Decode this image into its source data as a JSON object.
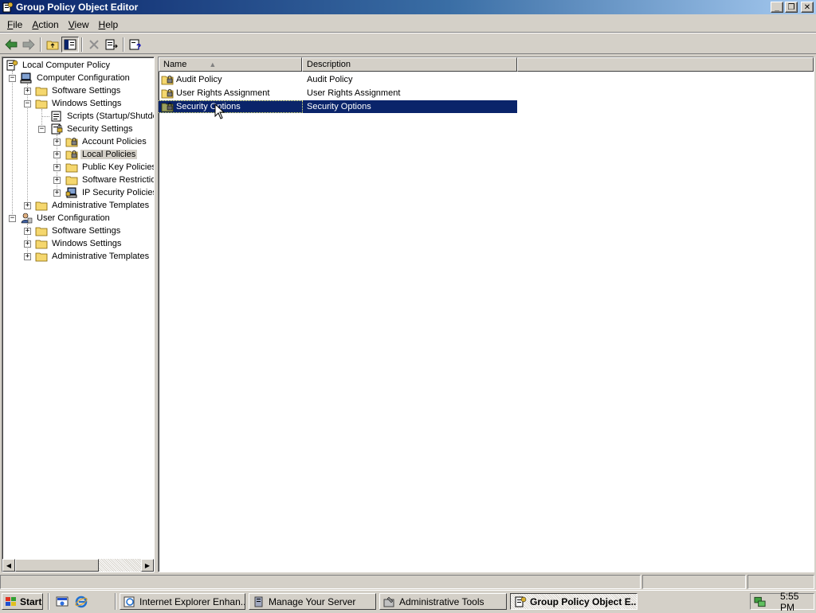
{
  "window": {
    "title": "Group Policy Object Editor",
    "controls": {
      "minimize": "_",
      "maximize": "❐",
      "close": "✕"
    }
  },
  "menubar": {
    "items": [
      {
        "label": "File",
        "accel": "F",
        "rest": "ile"
      },
      {
        "label": "Action",
        "accel": "A",
        "rest": "ction"
      },
      {
        "label": "View",
        "accel": "V",
        "rest": "iew"
      },
      {
        "label": "Help",
        "accel": "H",
        "rest": "elp"
      }
    ]
  },
  "toolbar": {
    "buttons": [
      "back-icon",
      "forward-icon",
      "up-folder-icon",
      "show-hide-tree-icon",
      "delete-icon",
      "export-list-icon",
      "help-icon"
    ]
  },
  "tree": {
    "items": [
      {
        "label": "Local Computer Policy",
        "icon": "policy-icon"
      },
      {
        "label": "Computer Configuration",
        "icon": "computer-icon",
        "expander": "−"
      },
      {
        "label": "Software Settings",
        "icon": "folder-icon",
        "expander": "+"
      },
      {
        "label": "Windows Settings",
        "icon": "folder-icon",
        "expander": "−"
      },
      {
        "label": "Scripts (Startup/Shutdown)",
        "icon": "script-icon"
      },
      {
        "label": "Security Settings",
        "icon": "security-icon",
        "expander": "−"
      },
      {
        "label": "Account Policies",
        "icon": "folder-lock-icon",
        "expander": "+"
      },
      {
        "label": "Local Policies",
        "icon": "folder-lock-icon",
        "expander": "+"
      },
      {
        "label": "Public Key Policies",
        "icon": "folder-icon",
        "expander": "+"
      },
      {
        "label": "Software Restriction Policies",
        "icon": "folder-icon",
        "expander": "+"
      },
      {
        "label": "IP Security Policies on Local Computer",
        "icon": "ipsec-icon",
        "expander": "+"
      },
      {
        "label": "Administrative Templates",
        "icon": "folder-icon",
        "expander": "+"
      },
      {
        "label": "User Configuration",
        "icon": "user-icon",
        "expander": "−"
      },
      {
        "label": "Software Settings",
        "icon": "folder-icon",
        "expander": "+"
      },
      {
        "label": "Windows Settings",
        "icon": "folder-icon",
        "expander": "+"
      },
      {
        "label": "Administrative Templates",
        "icon": "folder-icon",
        "expander": "+"
      }
    ],
    "selected": "Local Policies"
  },
  "list": {
    "columns": {
      "name": "Name",
      "description": "Description",
      "sort": "▲"
    },
    "rows": [
      {
        "name": "Audit Policy",
        "description": "Audit Policy"
      },
      {
        "name": "User Rights Assignment",
        "description": "User Rights Assignment"
      },
      {
        "name": "Security Options",
        "description": "Security Options"
      }
    ],
    "selected": "Security Options"
  },
  "taskbar": {
    "start_label": "Start",
    "quick_launch": [
      "show-desktop-icon",
      "internet-explorer-icon"
    ],
    "buttons": [
      {
        "label": "Internet Explorer Enhan...",
        "icon": "ie-doc-icon"
      },
      {
        "label": "Manage Your Server",
        "icon": "server-icon"
      },
      {
        "label": "Administrative Tools",
        "icon": "admin-tools-icon"
      },
      {
        "label": "Group Policy Object E...",
        "icon": "policy-icon",
        "active": true
      }
    ],
    "clock": "5:55 PM"
  },
  "colors": {
    "title_gradient_start": "#0a246a",
    "title_gradient_end": "#a6caf0",
    "selection": "#0a246a",
    "face": "#d4d0c8",
    "folder": "#f5d76e"
  }
}
